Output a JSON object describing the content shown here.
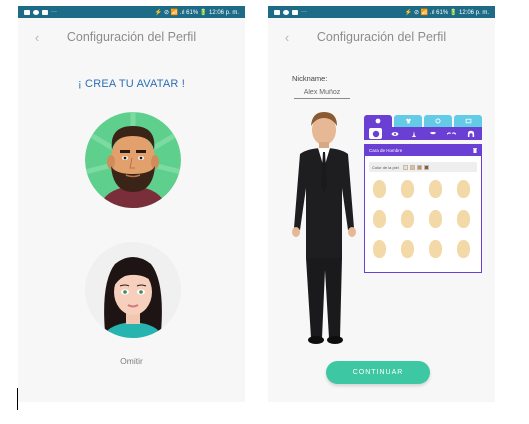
{
  "status_bar": {
    "notification_icons": [
      "image-icon",
      "camera-icon",
      "folder-icon"
    ],
    "overflow": "···",
    "right_text": "⚡ ⊘ 📶 .ıl 61% 🔋 12:06 p. m."
  },
  "screen_left": {
    "title": "Configuración del Perfil",
    "heading": "¡ CREA TU AVATAR !",
    "avatars": [
      {
        "name": "male-avatar",
        "icon": "bearded-man-avatar"
      },
      {
        "name": "female-avatar",
        "icon": "dark-hair-woman-avatar"
      }
    ],
    "skip_label": "Omitir"
  },
  "screen_right": {
    "title": "Configuración del Perfil",
    "nickname_label": "Nickname:",
    "nickname_value": "Alex Muñoz",
    "editor": {
      "category_tabs": [
        "head-icon",
        "shirt-icon",
        "accessory-icon",
        "background-icon"
      ],
      "feature_tabs": [
        "face-icon",
        "eye-icon",
        "nose-icon",
        "mouth-icon",
        "eyebrows-icon",
        "hair-icon"
      ],
      "panel_title": "Cara de Hombre",
      "skin_label": "Color de la piel",
      "skin_colors": [
        "#f7e0b5",
        "#e8b98a",
        "#c98d55",
        "#8a5a30"
      ],
      "head_shapes_count": 12
    },
    "continue_label": "CONTINUAR"
  },
  "colors": {
    "status_bar": "#1e6b87",
    "accent_blue": "#2a6fb6",
    "purple": "#6a3fd3",
    "cyan": "#63cbe6",
    "teal_button": "#3ec7a3",
    "skin": "#f3d8a8"
  }
}
